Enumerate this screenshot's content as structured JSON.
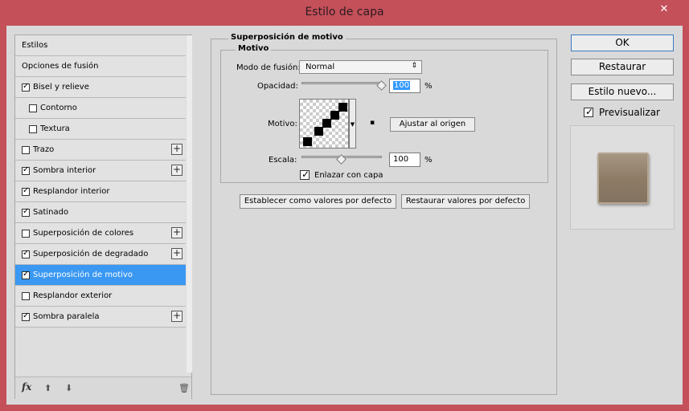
{
  "window": {
    "title": "Estilo de capa",
    "close_icon": "✕"
  },
  "styles_list": [
    {
      "label": "Estilos",
      "has_checkbox": false,
      "checked": false,
      "has_add": false,
      "indent": false,
      "selected": false
    },
    {
      "label": "Opciones de fusión",
      "has_checkbox": false,
      "checked": false,
      "has_add": false,
      "indent": false,
      "selected": false
    },
    {
      "label": "Bisel y relieve",
      "has_checkbox": true,
      "checked": true,
      "has_add": false,
      "indent": false,
      "selected": false
    },
    {
      "label": "Contorno",
      "has_checkbox": true,
      "checked": false,
      "has_add": false,
      "indent": true,
      "selected": false
    },
    {
      "label": "Textura",
      "has_checkbox": true,
      "checked": false,
      "has_add": false,
      "indent": true,
      "selected": false
    },
    {
      "label": "Trazo",
      "has_checkbox": true,
      "checked": false,
      "has_add": true,
      "indent": false,
      "selected": false
    },
    {
      "label": "Sombra interior",
      "has_checkbox": true,
      "checked": true,
      "has_add": true,
      "indent": false,
      "selected": false
    },
    {
      "label": "Resplandor interior",
      "has_checkbox": true,
      "checked": true,
      "has_add": false,
      "indent": false,
      "selected": false
    },
    {
      "label": "Satinado",
      "has_checkbox": true,
      "checked": true,
      "has_add": false,
      "indent": false,
      "selected": false
    },
    {
      "label": "Superposición de colores",
      "has_checkbox": true,
      "checked": false,
      "has_add": true,
      "indent": false,
      "selected": false
    },
    {
      "label": "Superposición de degradado",
      "has_checkbox": true,
      "checked": true,
      "has_add": true,
      "indent": false,
      "selected": false
    },
    {
      "label": "Superposición de motivo",
      "has_checkbox": true,
      "checked": true,
      "has_add": false,
      "indent": false,
      "selected": true
    },
    {
      "label": "Resplandor exterior",
      "has_checkbox": true,
      "checked": false,
      "has_add": false,
      "indent": false,
      "selected": false
    },
    {
      "label": "Sombra paralela",
      "has_checkbox": true,
      "checked": true,
      "has_add": true,
      "indent": false,
      "selected": false
    }
  ],
  "list_footer": {
    "fx_icon": "fx",
    "up_icon": "⬆",
    "down_icon": "⬇",
    "trash_icon": "🗑"
  },
  "panel": {
    "title": "Superposición de motivo",
    "group_title": "Motivo",
    "blend_mode_label": "Modo de fusión:",
    "blend_mode_value": "Normal",
    "opacity_label": "Opacidad:",
    "opacity_value": "100",
    "opacity_slider_fraction": 1.0,
    "percent": "%",
    "pattern_label": "Motivo:",
    "snap_button": "Ajustar al origen",
    "scale_label": "Escala:",
    "scale_value": "100",
    "scale_slider_fraction": 0.5,
    "link_label": "Enlazar con capa",
    "link_checked": true,
    "set_default_button": "Establecer como valores por defecto",
    "reset_default_button": "Restaurar valores por defecto"
  },
  "right": {
    "ok_button": "OK",
    "restore_button": "Restaurar",
    "new_style_button": "Estilo nuevo...",
    "preview_label": "Previsualizar",
    "preview_checked": true
  },
  "colors": {
    "selected_bg": "#3a98f2",
    "title_bar": "#c4505a",
    "preview_swatch": "#8e7c67"
  }
}
